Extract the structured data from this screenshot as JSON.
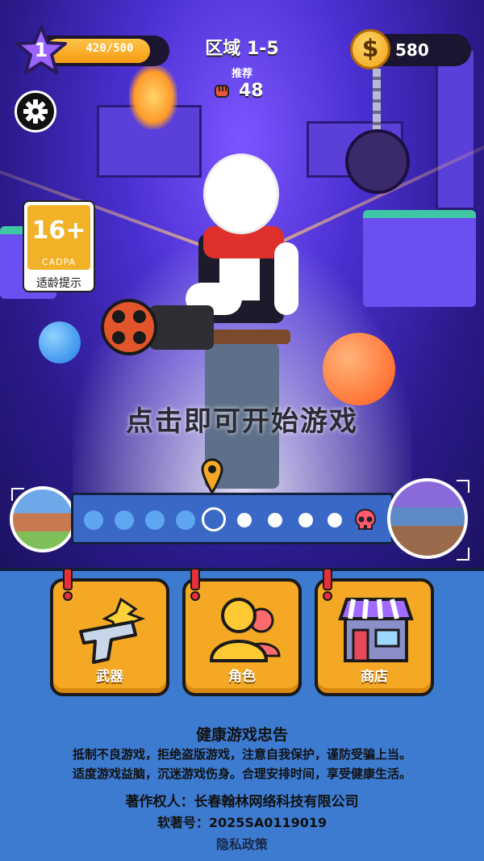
{
  "hud": {
    "player_level": "1",
    "xp_text": "420/500",
    "region_title": "区域 1-5",
    "recommend_label": "推荐",
    "recommend_power": "48",
    "coins": "580",
    "coin_symbol": "$"
  },
  "age_rating": {
    "age": "16+",
    "org": "CADPA",
    "tip": "适龄提示"
  },
  "start_prompt": "点击即可开始游戏",
  "stage_progress": {
    "completed": 4,
    "current": 5,
    "total": 9,
    "boss_icon": "skull-icon"
  },
  "menu": [
    {
      "label": "武器",
      "icon": "pistol-icon"
    },
    {
      "label": "角色",
      "icon": "characters-icon"
    },
    {
      "label": "商店",
      "icon": "shop-icon"
    }
  ],
  "health_notice": {
    "title": "健康游戏忠告",
    "lines": [
      "抵制不良游戏，拒绝盗版游戏，注意自我保护，谨防受骗上当。",
      "适度游戏益脑，沉迷游戏伤身。合理安排时间，享受健康生活。"
    ]
  },
  "copyright": "著作权人：长春翰林网络科技有限公司",
  "software_reg": "软著号：2025SA0119019",
  "privacy_link": "隐私政策",
  "colors": {
    "accent": "#f5a824",
    "panel": "#3d7bd1",
    "track": "#3a68c6"
  }
}
